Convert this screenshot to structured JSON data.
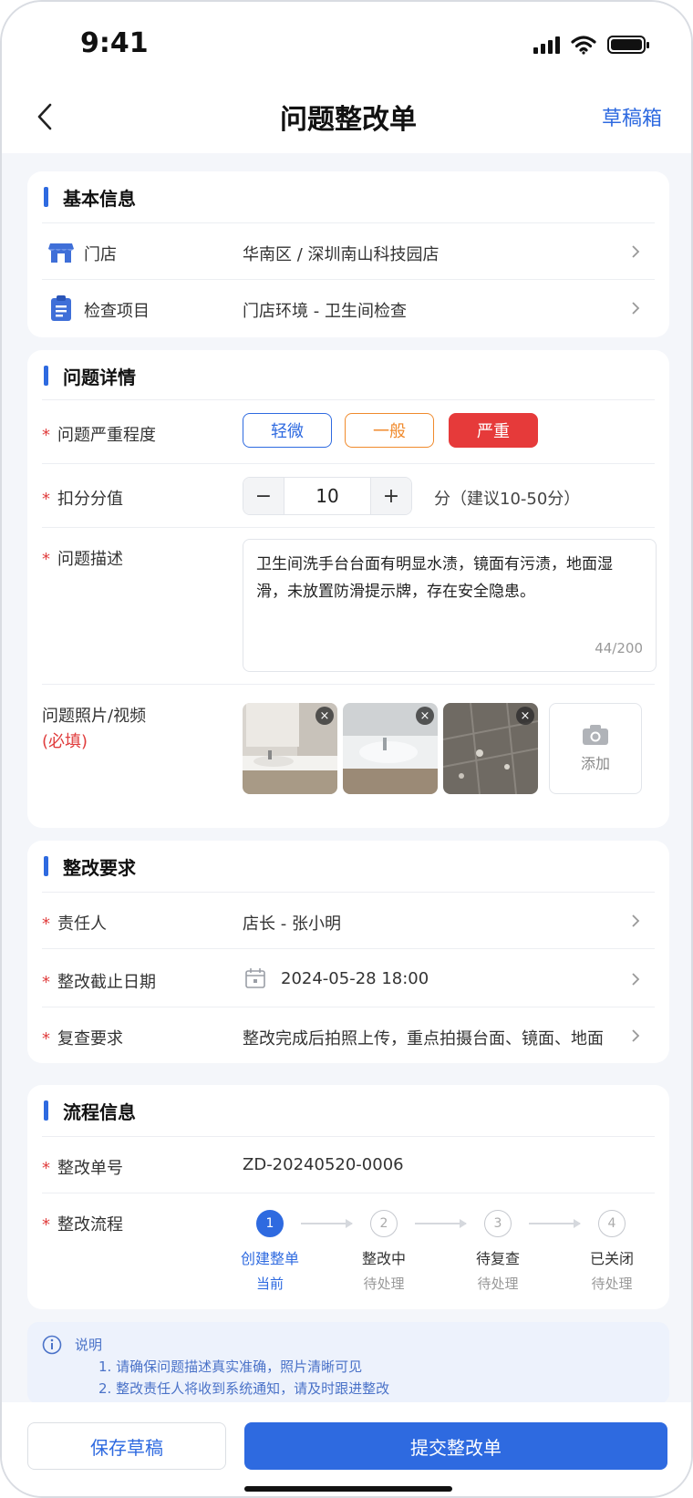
{
  "status_bar": {
    "time": "9:41"
  },
  "header": {
    "title": "问题整改单",
    "drafts_label": "草稿箱"
  },
  "basic_info": {
    "title": "基本信息",
    "store_label": "门店",
    "store_value": "华南区 / 深圳南山科技园店",
    "inspection_label": "检查项目",
    "inspection_value": "门店环境 - 卫生间检查"
  },
  "issue_details": {
    "title": "问题详情",
    "severity_label": "问题严重程度",
    "severity_options": [
      {
        "label": "轻微",
        "color": "#2e6ae0"
      },
      {
        "label": "一般",
        "color": "#f08a2c"
      },
      {
        "label": "严重",
        "color": "#e63a3a"
      }
    ],
    "severity_selected": "严重",
    "deduction_label": "扣分分值",
    "deduction_value": "10",
    "deduction_minus": "−",
    "deduction_plus": "+",
    "deduction_hint": "分（建议10-50分）",
    "description_label": "问题描述",
    "description_text": "卫生间洗手台台面有明显水渍，镜面有污渍，地面湿滑，未放置防滑提示牌，存在安全隐患。",
    "description_counter": "44/200",
    "photos_label": "问题照片/视频",
    "photos_required": "(必填)",
    "photos_add_label": "添加",
    "photo_remove_icon": "×"
  },
  "rectify_req": {
    "title": "整改要求",
    "owner_label": "责任人",
    "owner_value": "店长 - 张小明",
    "deadline_label": "整改截止日期",
    "deadline_value": "2024-05-28 18:00",
    "recheck_label": "复查要求",
    "recheck_value": "整改完成后拍照上传，重点拍摄台面、镜面、地面"
  },
  "process_info": {
    "title": "流程信息",
    "order_no_label": "整改单号",
    "order_no_value": "ZD-20240520-0006",
    "flow_label": "整改流程",
    "steps": [
      {
        "num": "1",
        "name": "创建整单",
        "state": "当前",
        "active": true
      },
      {
        "num": "2",
        "name": "整改中",
        "state": "待处理",
        "active": false
      },
      {
        "num": "3",
        "name": "待复查",
        "state": "待处理",
        "active": false
      },
      {
        "num": "4",
        "name": "已关闭",
        "state": "待处理",
        "active": false
      }
    ]
  },
  "note": {
    "title": "说明",
    "lines": [
      "1. 请确保问题描述真实准确，照片清晰可见",
      "2. 整改责任人将收到系统通知，请及时跟进整改"
    ]
  },
  "footer": {
    "save_draft_label": "保存草稿",
    "submit_label": "提交整改单"
  },
  "colors": {
    "primary": "#2e6ae0",
    "danger": "#e63a3a",
    "warning": "#f08a2c"
  }
}
